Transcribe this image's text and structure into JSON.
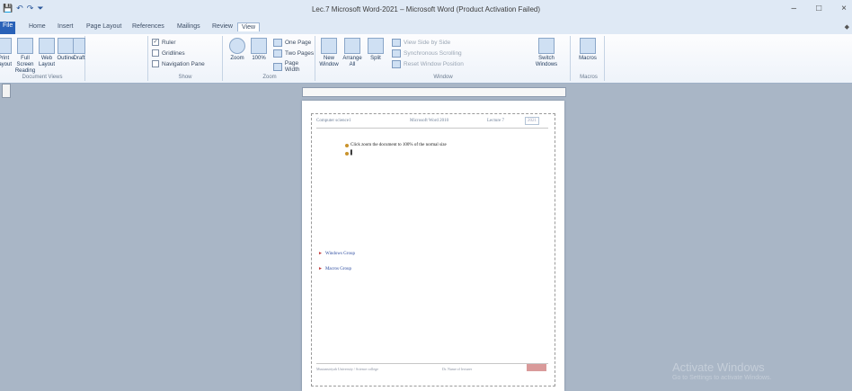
{
  "window": {
    "title": "Lec.7 Microsoft Word-2021 – Microsoft Word (Product Activation Failed)",
    "minimize": "–",
    "maximize": "□",
    "close": "×"
  },
  "qat": {
    "save": "💾",
    "undo": "↶",
    "redo": "↷",
    "customize": "⏷"
  },
  "tabs": [
    "File",
    "Home",
    "Insert",
    "Page Layout",
    "References",
    "Mailings",
    "Review",
    "View"
  ],
  "active_tab": "View",
  "help_icon": "◆",
  "ribbon": {
    "document_views": {
      "label": "Document Views",
      "buttons": [
        "Print Layout",
        "Full Screen Reading",
        "Web Layout",
        "Outline",
        "Draft"
      ]
    },
    "show": {
      "label": "Show",
      "items": [
        {
          "label": "Ruler",
          "checked": true
        },
        {
          "label": "Gridlines",
          "checked": false
        },
        {
          "label": "Navigation Pane",
          "checked": false
        }
      ]
    },
    "zoom": {
      "label": "Zoom",
      "buttons": [
        "Zoom",
        "100%"
      ],
      "items": [
        "One Page",
        "Two Pages",
        "Page Width"
      ]
    },
    "window": {
      "label": "Window",
      "buttons": [
        "New Window",
        "Arrange All",
        "Split"
      ],
      "items": [
        "View Side by Side",
        "Synchronous Scrolling",
        "Reset Window Position"
      ],
      "switch": "Switch Windows"
    },
    "macros": {
      "label": "Macros",
      "button": "Macros"
    }
  },
  "document": {
    "header_left": "Computer science1",
    "header_center": "Microsoft Word 2010",
    "header_right": "Lecture 7",
    "header_year": "2021",
    "bullet1": "Click      zoom the document to 100% of the normal size",
    "section1": "Windows Group",
    "section2": "Macros Group",
    "footer_left": "Mustansiriyah University / Science  college",
    "footer_center": "Dr. Name of lecturer"
  },
  "watermark": {
    "title": "Activate Windows",
    "subtitle": "Go to Settings to activate Windows."
  }
}
